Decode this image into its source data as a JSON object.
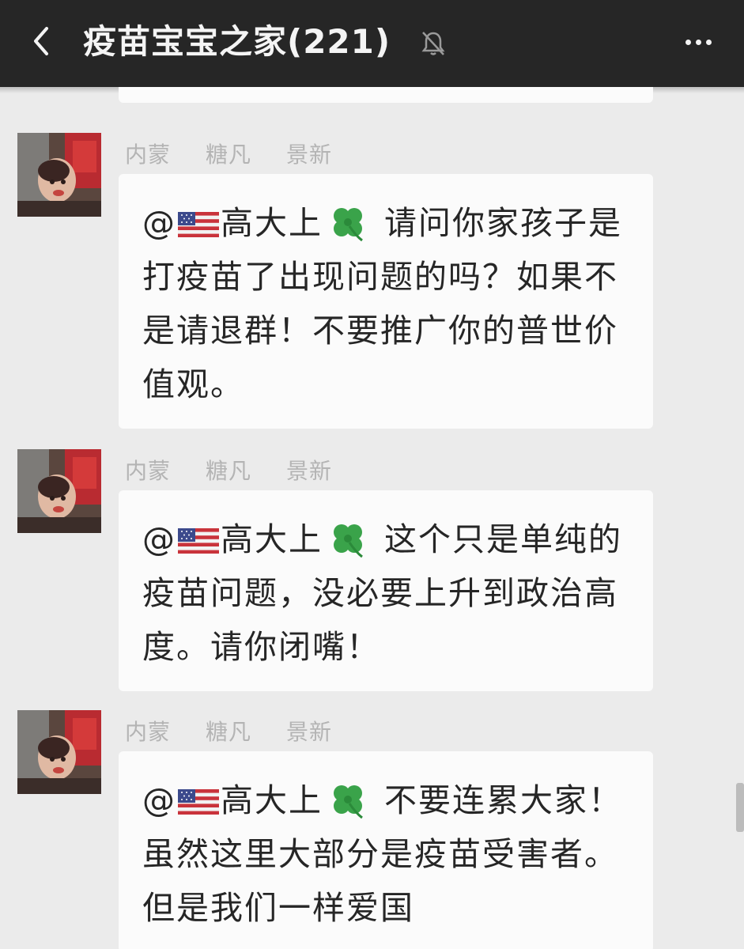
{
  "header": {
    "title": "疫苗宝宝之家(221)",
    "back_icon": "chevron-left-icon",
    "mute_icon": "bell-muted-icon",
    "more_icon": "more-dots-icon"
  },
  "messages": [
    {
      "sender": [
        "内蒙",
        "糖凡",
        "景新"
      ],
      "mention": "@",
      "mention_name": "高大上",
      "text": "请问你家孩子是打疫苗了出现问题的吗？如果不是请退群！不要推广你的普世价值观。"
    },
    {
      "sender": [
        "内蒙",
        "糖凡",
        "景新"
      ],
      "mention": "@",
      "mention_name": "高大上",
      "text": "这个只是单纯的疫苗问题，没必要上升到政治高度。请你闭嘴！"
    },
    {
      "sender": [
        "内蒙",
        "糖凡",
        "景新"
      ],
      "mention": "@",
      "mention_name": "高大上",
      "text": "不要连累大家！虽然这里大部分是疫苗受害者。但是我们一样爱国"
    }
  ],
  "colors": {
    "header_bg": "#262626",
    "chat_bg": "#ebebeb",
    "bubble_bg": "#fbfbfb",
    "clover_green": "#3aa34a"
  }
}
